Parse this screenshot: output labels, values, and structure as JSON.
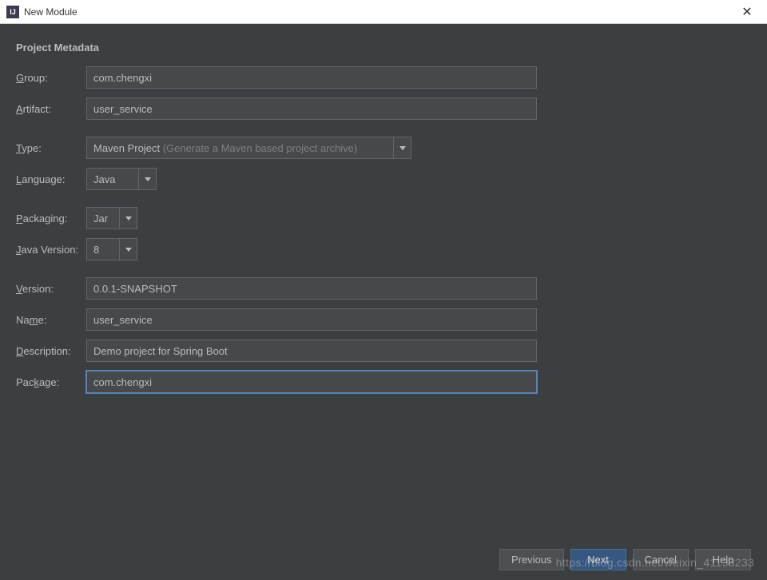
{
  "window": {
    "title": "New Module"
  },
  "section_title": "Project Metadata",
  "labels": {
    "group": "Group:",
    "artifact": "Artifact:",
    "type": "Type:",
    "language": "Language:",
    "packaging": "Packaging:",
    "java_version": "Java Version:",
    "version": "Version:",
    "name": "Name:",
    "description": "Description:",
    "package": "Package:"
  },
  "values": {
    "group": "com.chengxi",
    "artifact": "user_service",
    "type_main": "Maven Project",
    "type_hint": " (Generate a Maven based project archive)",
    "language": "Java",
    "packaging": "Jar",
    "java_version": "8",
    "version": "0.0.1-SNAPSHOT",
    "name": "user_service",
    "description": "Demo project for Spring Boot",
    "package": "com.chengxi"
  },
  "buttons": {
    "previous": "Previous",
    "next": "Next",
    "cancel": "Cancel",
    "help": "Help"
  },
  "watermark": "https://blog.csdn.net/weixin_41133233"
}
